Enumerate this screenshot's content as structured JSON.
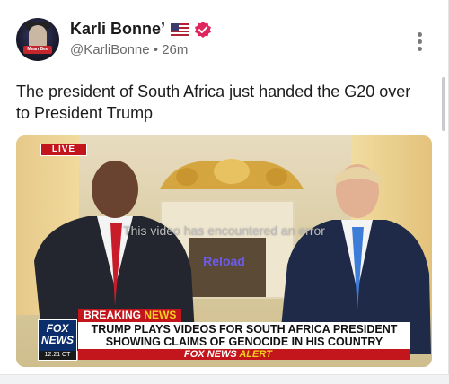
{
  "post": {
    "author_name": "Karli Bonne’",
    "handle": "@KarliBonne",
    "time": "26m",
    "separator": "•",
    "text": "The president of South Africa just handed the G20 over to President Trump",
    "avatar_tag": "Mean Bee"
  },
  "video": {
    "live_label": "LIVE",
    "error_message": "This video has encountered an error",
    "reload_label": "Reload",
    "breaking_label": "BREAKING",
    "breaking_news_label": "NEWS",
    "headline_line1": "TRUMP PLAYS VIDEOS FOR SOUTH AFRICA PRESIDENT",
    "headline_line2": "SHOWING CLAIMS OF GENOCIDE IN HIS COUNTRY",
    "network_line1": "FOX",
    "network_line2": "NEWS",
    "clock": "12:21 CT",
    "alert_prefix": "FOX NEWS",
    "alert_word": "ALERT"
  },
  "colors": {
    "verified": "#e0245e",
    "reload": "#6c5ce7",
    "fox_red": "#c3161c",
    "fox_blue": "#0b2d6b"
  },
  "icons": {
    "flag": "us-flag-icon",
    "verified": "verified-badge-icon",
    "more": "more-vertical-icon"
  }
}
